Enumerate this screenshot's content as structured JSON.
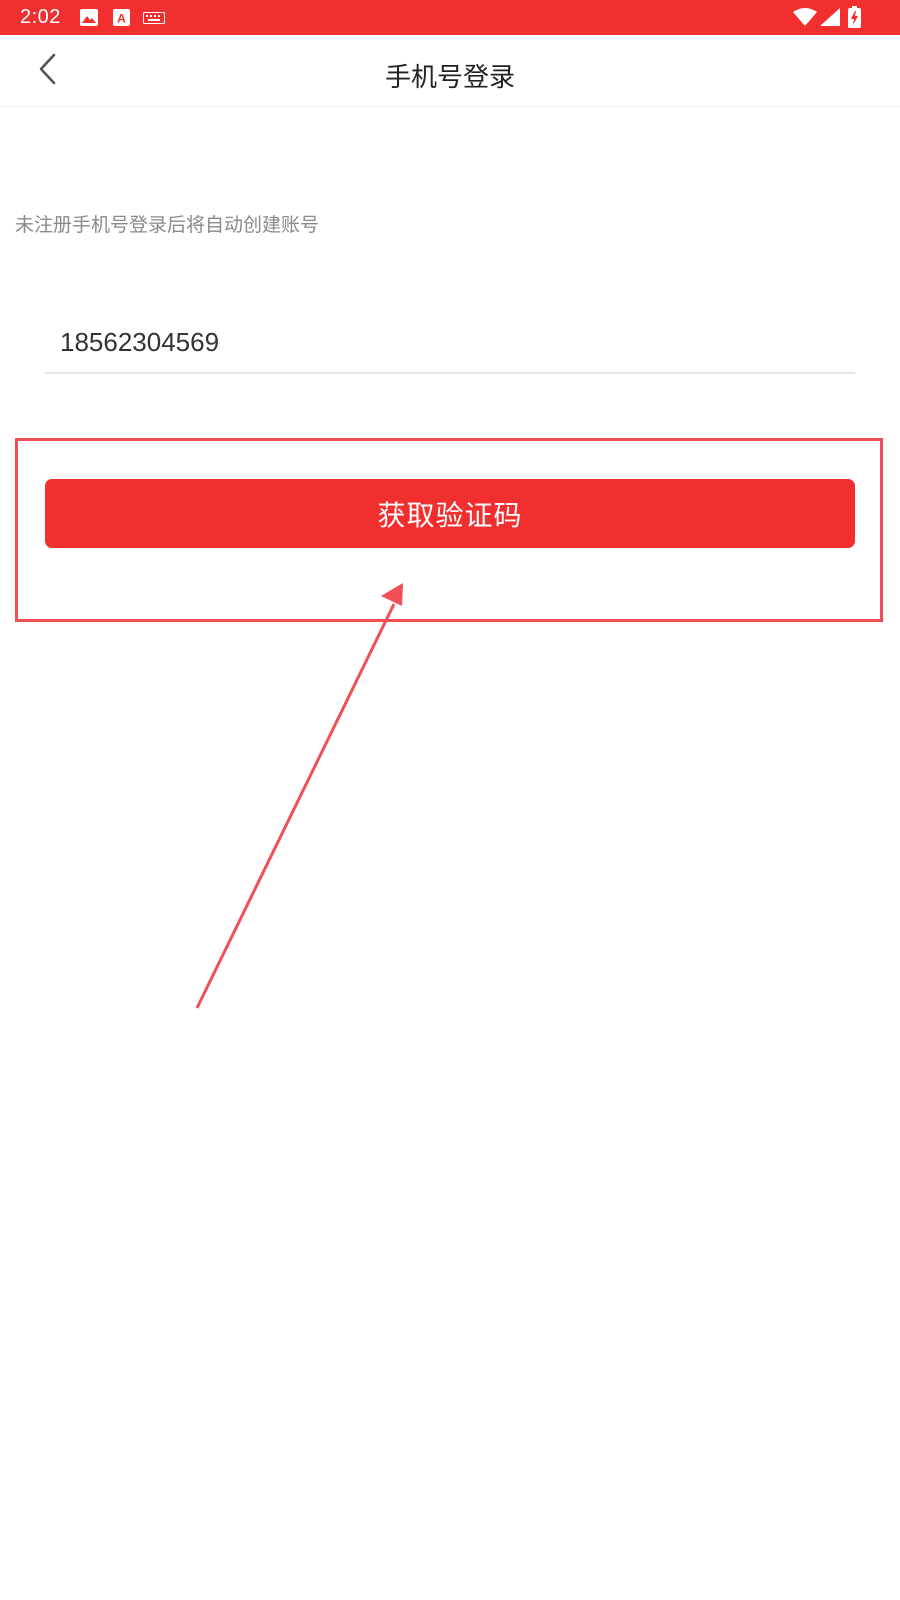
{
  "status_bar": {
    "time": "2:02",
    "bg_color": "#f22f2f",
    "left_icons": [
      "image-icon",
      "font-app-icon",
      "keyboard-icon"
    ],
    "right_icons": [
      "wifi-icon",
      "signal-icon",
      "battery-charging-icon"
    ]
  },
  "header": {
    "title": "手机号登录",
    "back_icon": "chevron-left-icon"
  },
  "form": {
    "hint": "未注册手机号登录后将自动创建账号",
    "phone_value": "18562304569",
    "submit_label": "获取验证码"
  },
  "annotation": {
    "highlight_color": "#f05055"
  },
  "colors": {
    "accent": "#f22f2f",
    "hint_text": "#8a8a8a"
  }
}
